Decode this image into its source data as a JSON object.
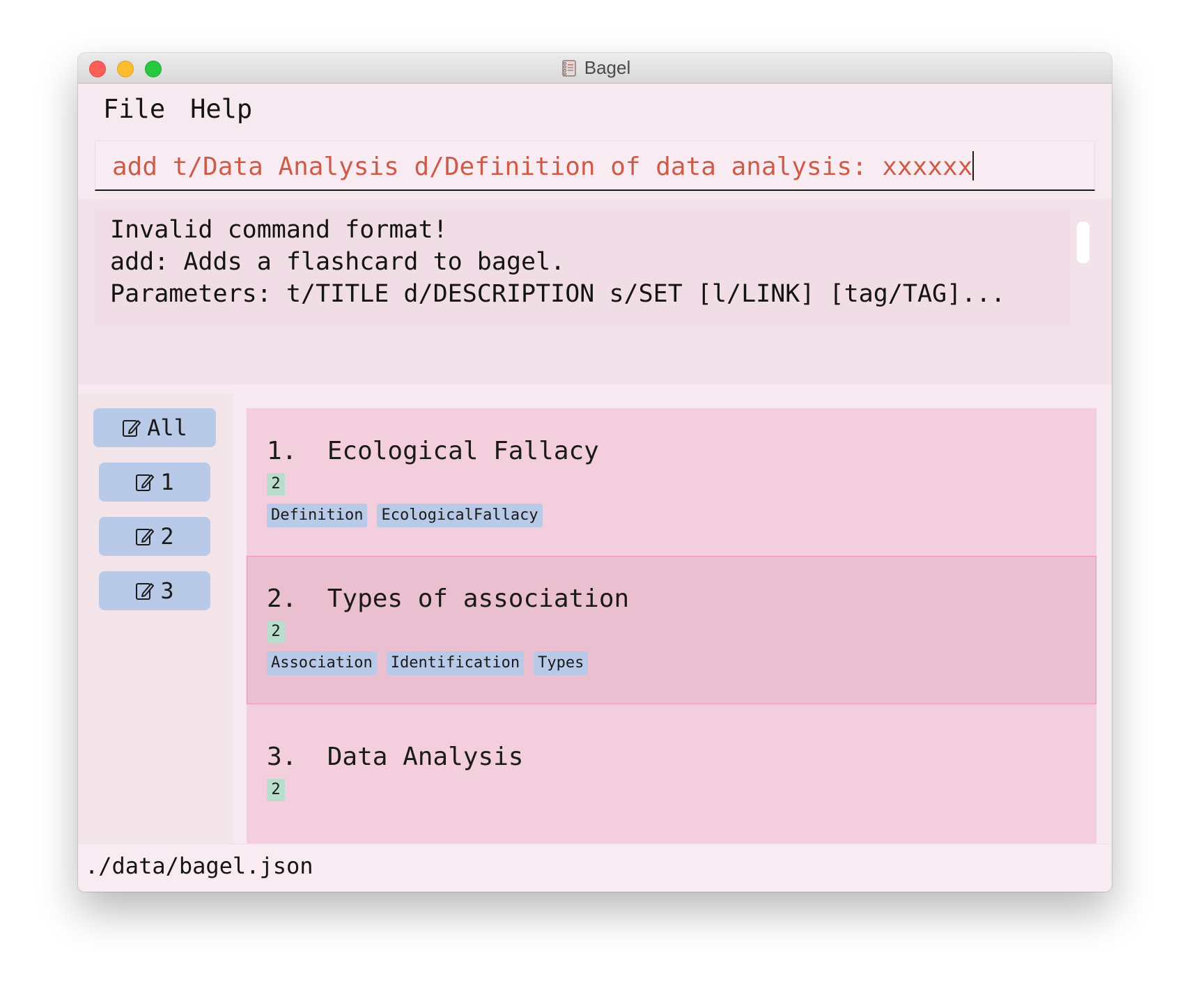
{
  "window": {
    "title": "Bagel",
    "app_icon": "notebook-icon"
  },
  "menu": {
    "file": "File",
    "help": "Help"
  },
  "command": {
    "value": "add t/Data Analysis d/Definition of data analysis: xxxxxx"
  },
  "result": {
    "lines": [
      "Invalid command format!",
      "add: Adds a flashcard to bagel.",
      "Parameters: t/TITLE d/DESCRIPTION s/SET [l/LINK] [tag/TAG]..."
    ]
  },
  "sidebar": {
    "icon": "edit-icon",
    "items": [
      {
        "label": "All"
      },
      {
        "label": "1"
      },
      {
        "label": "2"
      },
      {
        "label": "3"
      }
    ]
  },
  "cards": [
    {
      "index": "1.",
      "title": "Ecological Fallacy",
      "set": "2",
      "tags": [
        "Definition",
        "EcologicalFallacy"
      ],
      "selected": false
    },
    {
      "index": "2.",
      "title": "Types of association",
      "set": "2",
      "tags": [
        "Association",
        "Identification",
        "Types"
      ],
      "selected": true
    },
    {
      "index": "3.",
      "title": "Data Analysis",
      "set": "2",
      "tags": [],
      "selected": false
    }
  ],
  "status": {
    "path": "./data/bagel.json"
  },
  "colors": {
    "command_text": "#cc5c49",
    "card_bg": "#f3cfdd",
    "card_selected_bg": "#eabfcf",
    "tag_bg": "#b9c9e8",
    "set_badge_bg": "#b8ddcc"
  }
}
